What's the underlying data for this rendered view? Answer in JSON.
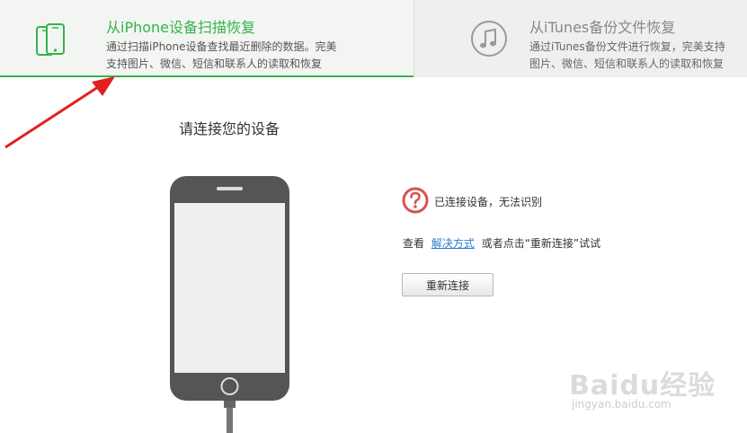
{
  "tabs": [
    {
      "title": "从iPhone设备扫描恢复",
      "desc_line1": "通过扫描iPhone设备查找最近删除的数据。完美",
      "desc_line2": "支持图片、微信、短信和联系人的读取和恢复",
      "icon": "phone-icon",
      "active": true
    },
    {
      "title": "从iTunes备份文件恢复",
      "desc_line1": "通过iTunes备份文件进行恢复，完美支持",
      "desc_line2": "图片、微信、短信和联系人的读取和恢复",
      "icon": "music-note-icon",
      "active": false
    }
  ],
  "main": {
    "heading": "请连接您的设备",
    "status_text": "已连接设备，无法识别",
    "hint_prefix": "查看",
    "hint_link": "解决方式",
    "hint_suffix": "或者点击“重新连接”试试",
    "reconnect_label": "重新连接"
  },
  "watermark": {
    "brand": "Baidu经验",
    "url": "jingyan.baidu.com"
  },
  "colors": {
    "accent": "#34b34c",
    "link": "#2f7fd0",
    "warning": "#d9534f",
    "phone_body": "#555555",
    "annotation_arrow": "#e02020"
  }
}
